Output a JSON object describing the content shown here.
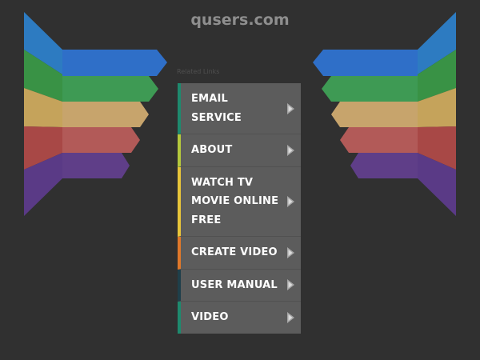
{
  "site": {
    "title": "qusers.com"
  },
  "related_links_label": "Related Links",
  "menu": [
    {
      "label": "EMAIL SERVICE",
      "accent": "#1e8a6e"
    },
    {
      "label": "ABOUT",
      "accent": "#b4c83c"
    },
    {
      "label": "WATCH TV MOVIE ONLINE FREE",
      "accent": "#e8c53a"
    },
    {
      "label": "CREATE VIDEO",
      "accent": "#e0782a"
    },
    {
      "label": "USER MANUAL",
      "accent": "#1f3f4a"
    },
    {
      "label": "VIDEO",
      "accent": "#1e8a6e"
    }
  ],
  "wing_colors": [
    "#2f7fc8",
    "#3c9a4e",
    "#c8a45e",
    "#b04d4b",
    "#5a3a86"
  ],
  "icons": {
    "menu_arrow": "chevron-right-icon"
  }
}
